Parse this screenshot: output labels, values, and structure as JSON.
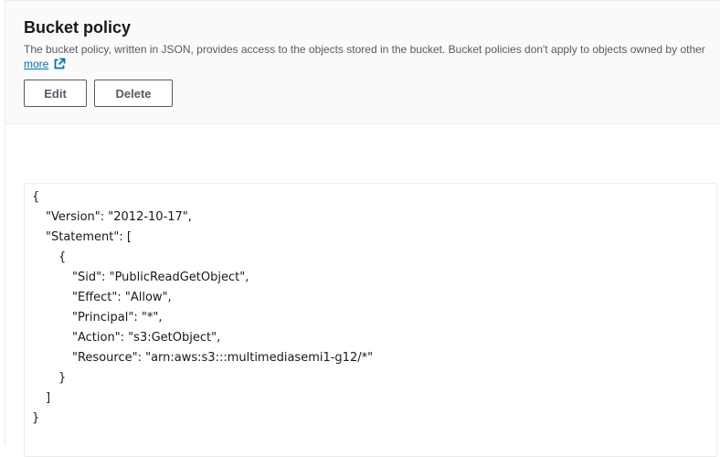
{
  "header": {
    "title": "Bucket policy",
    "description": "The bucket policy, written in JSON, provides access to the objects stored in the bucket. Bucket policies don't apply to objects owned by other",
    "learn_more_label": "more",
    "external_icon": "external-link-icon"
  },
  "actions": {
    "edit_label": "Edit",
    "delete_label": "Delete"
  },
  "policy": {
    "lines": [
      "{",
      "\"Version\": \"2012-10-17\",",
      "\"Statement\": [",
      "{",
      "\"Sid\": \"PublicReadGetObject\",",
      "\"Effect\": \"Allow\",",
      "\"Principal\": \"*\",",
      "\"Action\": \"s3:GetObject\",",
      "\"Resource\": \"arn:aws:s3:::multimediasemi1-g12/*\"",
      "}",
      "]",
      "}"
    ]
  },
  "colors": {
    "link": "#0073bb",
    "text": "#16191f",
    "secondary_text": "#545b64",
    "header_bg": "#fafafa",
    "border": "#eaeded"
  }
}
